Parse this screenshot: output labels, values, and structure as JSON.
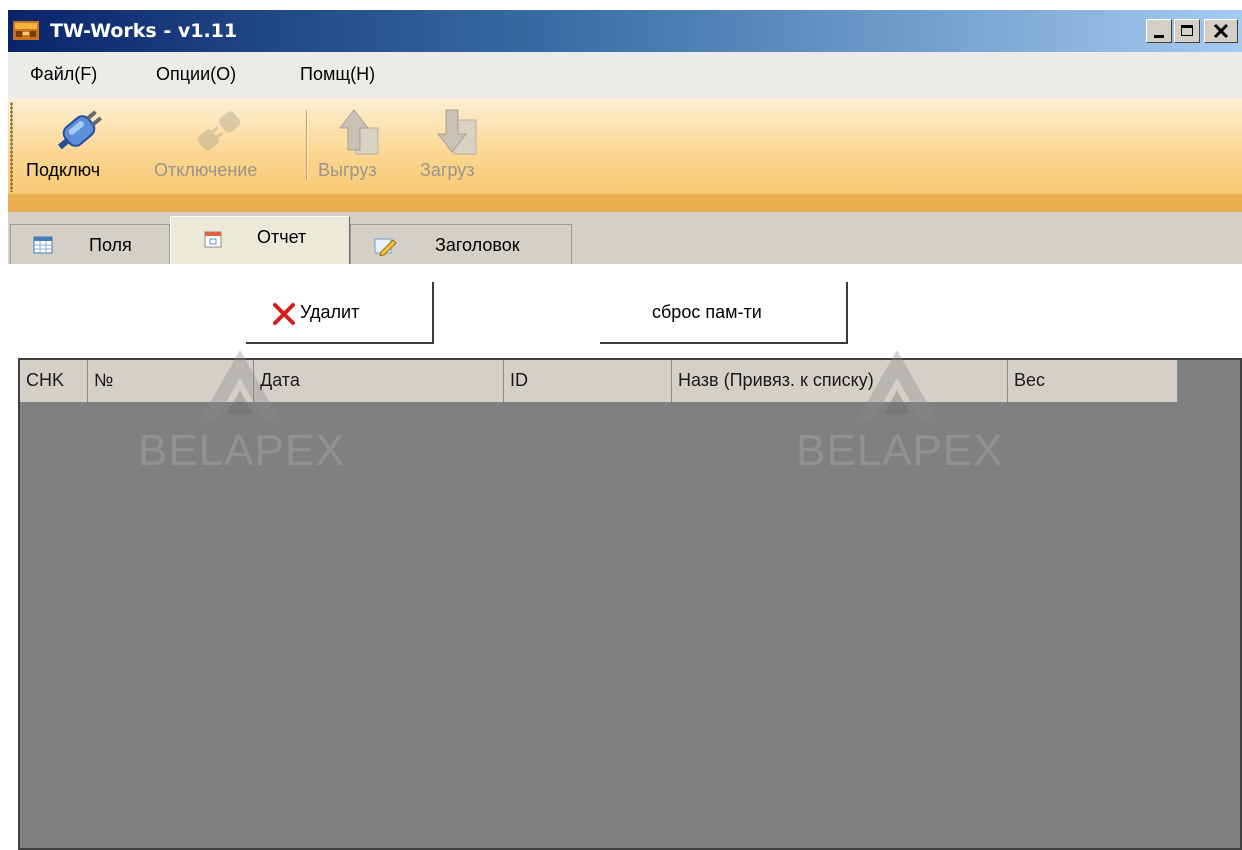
{
  "window": {
    "title": "TW-Works - v1.11",
    "controls": [
      "_",
      "□",
      "X"
    ]
  },
  "menu": [
    {
      "label": "Файл(F)"
    },
    {
      "label": "Опции(O)"
    },
    {
      "label": "Помщ(H)"
    }
  ],
  "toolbar": {
    "connect": {
      "label": "Подключ",
      "icon": "plug-connect-icon",
      "enabled": true
    },
    "disconnect": {
      "label": "Отключение",
      "icon": "plug-disconnect-icon",
      "enabled": false
    },
    "upload": {
      "label": "Выгруз",
      "icon": "upload-arrow-icon",
      "enabled": false
    },
    "download": {
      "label": "Загруз",
      "icon": "download-arrow-icon",
      "enabled": false
    }
  },
  "tabs": [
    {
      "label": "Поля",
      "icon": "table-icon",
      "active": false
    },
    {
      "label": "Отчет",
      "icon": "calendar-icon",
      "active": true
    },
    {
      "label": "Заголовок",
      "icon": "edit-icon",
      "active": false
    }
  ],
  "actions": {
    "delete_label": "Удалит",
    "reset_label": "сброс пам-ти"
  },
  "grid": {
    "columns": [
      "CHK",
      "№",
      "Дата",
      "ID",
      "Назв (Привяз. к списку)",
      "Вес"
    ],
    "rows": []
  },
  "watermark": "BELAPEX",
  "colors": {
    "title_start": "#0a246a",
    "title_end": "#a6caf0",
    "toolbar": "#fbd793",
    "grid_background": "#808080",
    "delete_icon": "#d42020"
  }
}
